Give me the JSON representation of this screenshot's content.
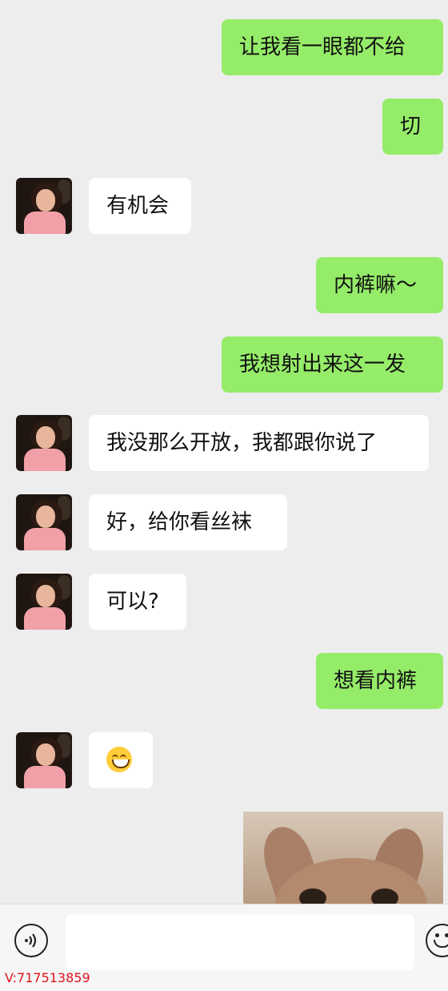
{
  "messages": [
    {
      "side": "out",
      "text": "让我看一眼都不给"
    },
    {
      "side": "out",
      "text": "切"
    },
    {
      "side": "in",
      "text": "有机会"
    },
    {
      "side": "out",
      "text": "内裤嘛～"
    },
    {
      "side": "out",
      "text": "我想射出来这一发"
    },
    {
      "side": "in",
      "text": "我没那么开放，我都跟你说了"
    },
    {
      "side": "in",
      "text": "好，给你看丝袜"
    },
    {
      "side": "in",
      "text": "可以?"
    },
    {
      "side": "out",
      "text": "想看内裤"
    },
    {
      "side": "in",
      "emoji": "grinning-face-emoji"
    },
    {
      "side": "out",
      "image": "cat-photo"
    }
  ],
  "input": {
    "placeholder": "",
    "value": ""
  },
  "toolbar": {
    "voice_icon": "voice-icon",
    "emoji_icon": "emoji-icon"
  },
  "watermark": "V:717513859",
  "colors": {
    "outgoing_bubble": "#95ec69",
    "incoming_bubble": "#ffffff",
    "background": "#ededed",
    "watermark": "#e0141e"
  }
}
